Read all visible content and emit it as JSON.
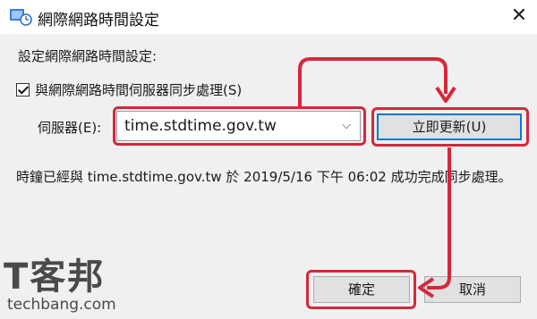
{
  "window": {
    "title": "網際網路時間設定",
    "icons": {
      "app": "network-clock-icon",
      "close": "close-icon"
    }
  },
  "section_label": "設定網際網路時間設定:",
  "sync_checkbox": {
    "label": "與網際網路時間伺服器同步處理(S)",
    "checked": true
  },
  "server": {
    "label": "伺服器(E):",
    "value": "time.stdtime.gov.tw"
  },
  "update_button": "立即更新(U)",
  "status_text": "時鐘已經與 time.stdtime.gov.tw 於 2019/5/16 下午 06:02 成功完成同步處理。",
  "ok_button": "確定",
  "cancel_button": "取消",
  "watermark": {
    "logo": "T客邦",
    "domain": "techbang.com"
  },
  "highlight_color": "#d6273a"
}
